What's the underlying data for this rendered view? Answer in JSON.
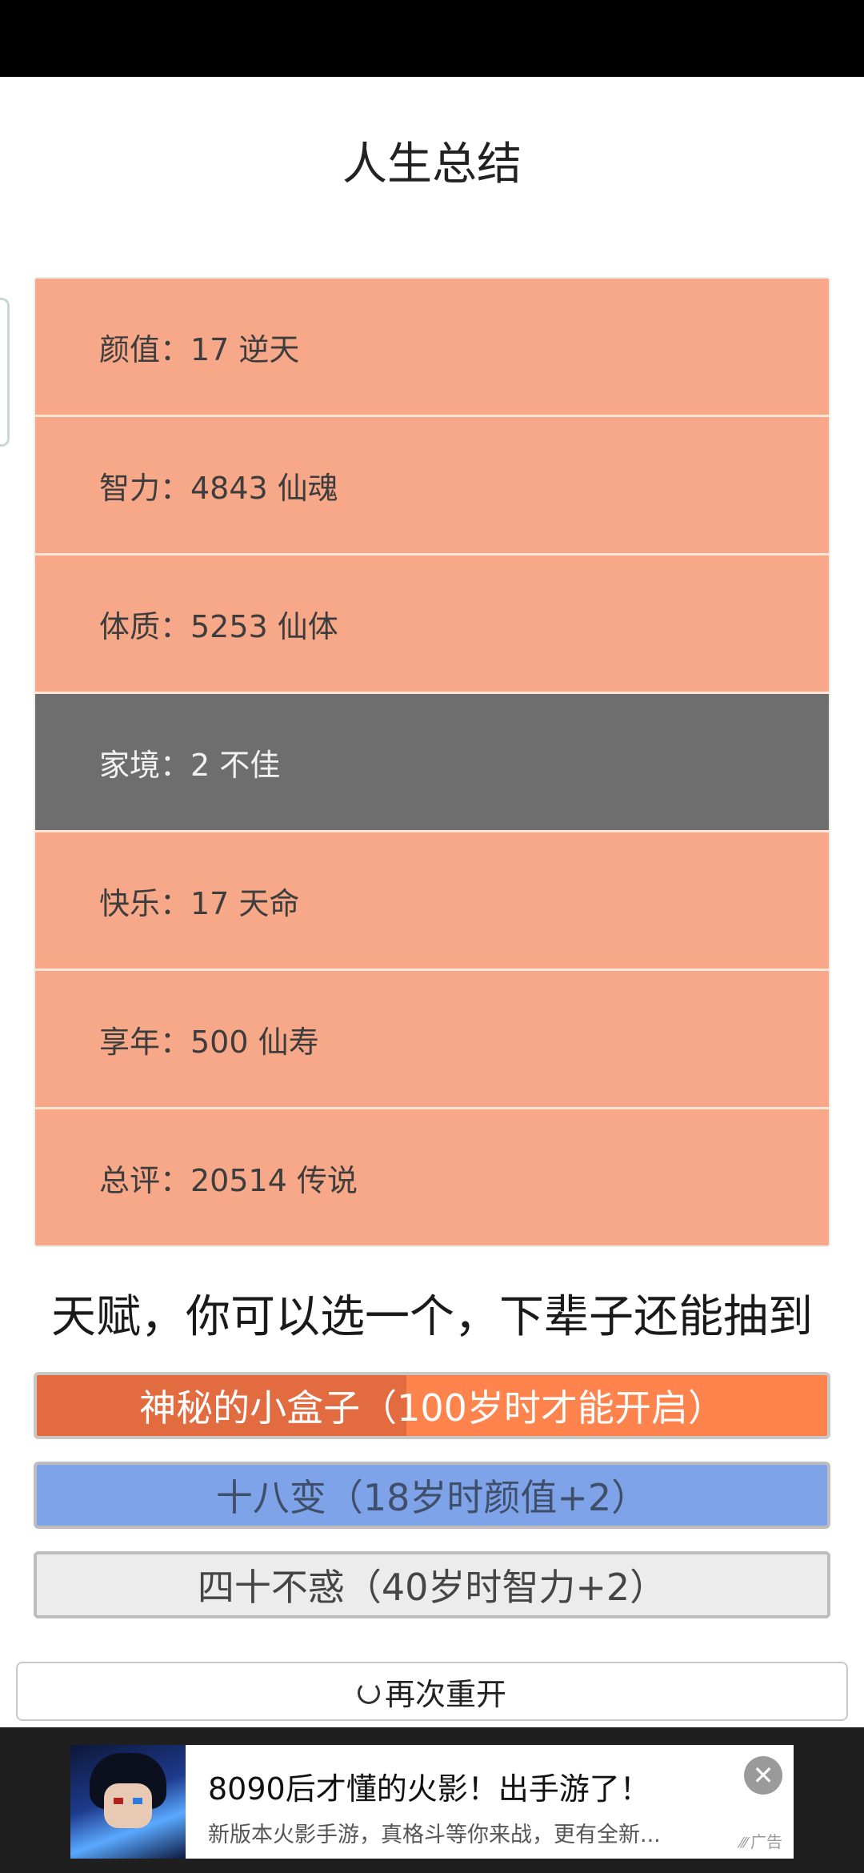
{
  "page": {
    "title": "人生总结"
  },
  "summary": {
    "rows": [
      {
        "label": "颜值：17 逆天",
        "state": "highlight"
      },
      {
        "label": "智力：4843 仙魂",
        "state": "highlight"
      },
      {
        "label": "体质：5253 仙体",
        "state": "highlight"
      },
      {
        "label": "家境：2 不佳",
        "state": "dark"
      },
      {
        "label": "快乐：17 天命",
        "state": "highlight"
      },
      {
        "label": "享年：500 仙寿",
        "state": "highlight"
      },
      {
        "label": "总评：20514 传说",
        "state": "highlight"
      }
    ]
  },
  "talents": {
    "heading": "天赋，你可以选一个，下辈子还能抽到",
    "items": [
      {
        "label": "神秘的小盒子（100岁时才能开启）",
        "color": "#ff834c"
      },
      {
        "label": "十八变（18岁时颜值+2）",
        "color": "#7fa3e8"
      },
      {
        "label": "四十不惑（40岁时智力+2）",
        "color": "#ececec"
      }
    ]
  },
  "actions": {
    "restart_label": "再次重开",
    "restart_icon": "refresh-icon"
  },
  "ad": {
    "title": "8090后才懂的火影！出手游了！",
    "description": "新版本火影手游，真格斗等你来战，更有全新...",
    "badge": "广告",
    "close_icon": "close-icon"
  },
  "colors": {
    "row_highlight": "#f6a889",
    "row_dark": "#6e6e6e"
  }
}
